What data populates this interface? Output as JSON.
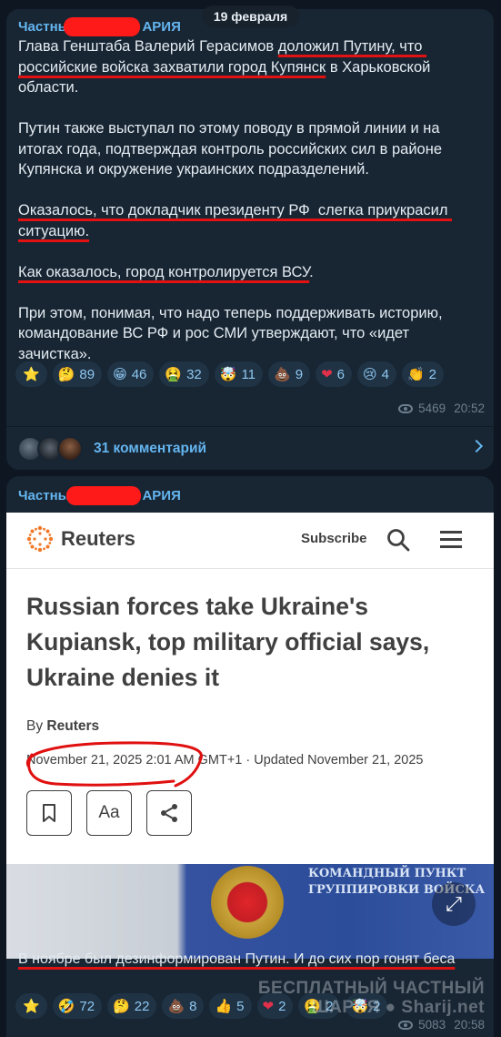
{
  "date_separator": "19 февраля",
  "message1": {
    "channel_left": "Частны",
    "channel_right": "АРИЯ",
    "paragraphs": [
      {
        "segments": [
          {
            "text": "Глава Генштаба Валерий Герасимов ",
            "u": false
          },
          {
            "text": "доложил Путину, что российские войска захватили город Купянск",
            "u": true
          },
          {
            "text": " в Харьковской области.",
            "u": false
          }
        ]
      },
      {
        "segments": [
          {
            "text": "Путин также выступал по этому поводу в прямой линии и на итогах года, подтверждая контроль российских сил в районе Купянска и окружение украинских подразделений.",
            "u": false
          }
        ]
      },
      {
        "segments": [
          {
            "text": "Оказалось, что докладчик президенту РФ  слегка приукрасил ситуацию.",
            "u": true
          }
        ]
      },
      {
        "segments": [
          {
            "text": "Как оказалось, город контролируется ВСУ",
            "u": true
          },
          {
            "text": ".",
            "u": false
          }
        ]
      },
      {
        "segments": [
          {
            "text": "При этом, понимая, что надо теперь поддерживать историю, командование ВС РФ и рос СМИ утверждают, что «идет зачистка».",
            "u": false
          }
        ]
      }
    ],
    "reactions": [
      {
        "icon": "⭐",
        "name": "star-reaction",
        "count": ""
      },
      {
        "icon": "🤔",
        "name": "thinking-reaction",
        "count": "89"
      },
      {
        "icon": "😁",
        "name": "grin-reaction",
        "count": "46"
      },
      {
        "icon": "🤮",
        "name": "vomit-reaction",
        "count": "32"
      },
      {
        "icon": "🤯",
        "name": "mind-blown-reaction",
        "count": "11"
      },
      {
        "icon": "💩",
        "name": "poop-reaction",
        "count": "9"
      },
      {
        "icon": "❤",
        "name": "heart-reaction",
        "count": "6"
      },
      {
        "icon": "😢",
        "name": "cry-reaction",
        "count": "4"
      },
      {
        "icon": "👏",
        "name": "clap-reaction",
        "count": "2"
      }
    ],
    "views": "5469",
    "time": "20:52",
    "comments_label": "31 комментарий"
  },
  "message2": {
    "channel_left": "Частны",
    "channel_right": "АРИЯ",
    "article": {
      "brand": "Reuters",
      "subscribe": "Subscribe",
      "headline": "Russian forces take Ukraine's Kupiansk, top military official says, Ukraine denies it",
      "by_prefix": "By",
      "by_name": "Reuters",
      "date": "November 21, 2025 2:01 AM GMT+1 · Updated November 21, 2025",
      "text_size_label": "Aa",
      "photo_sign_line1": "КОМАНДНЫЙ ПУНКТ",
      "photo_sign_line2": "ГРУППИРОВКИ ВОЙСКА"
    },
    "caption": "В ноябре был дезинформирован Путин. И до сих пор гонят беса",
    "reactions": [
      {
        "icon": "⭐",
        "name": "star-reaction",
        "count": ""
      },
      {
        "icon": "🤣",
        "name": "rofl-reaction",
        "count": "72"
      },
      {
        "icon": "🤔",
        "name": "thinking-reaction",
        "count": "22"
      },
      {
        "icon": "💩",
        "name": "poop-reaction",
        "count": "8"
      },
      {
        "icon": "👍",
        "name": "thumbs-up-reaction",
        "count": "5"
      },
      {
        "icon": "❤",
        "name": "heart-reaction",
        "count": "2"
      },
      {
        "icon": "🤮",
        "name": "vomit-reaction",
        "count": "2"
      },
      {
        "icon": "🤯",
        "name": "mind-blown-reaction",
        "count": "2"
      }
    ],
    "views": "5083",
    "time": "20:58",
    "watermark_line1": "БЕСПЛАТНЫЙ ЧАСТНЫЙ",
    "watermark_line2": "ШАРИЯ ● Sharij.net"
  },
  "colors": {
    "background": "#0e1621",
    "bubble": "#182533",
    "accent": "#64b5ef",
    "redaction": "#ff1a1a",
    "underline": "#e21212"
  }
}
